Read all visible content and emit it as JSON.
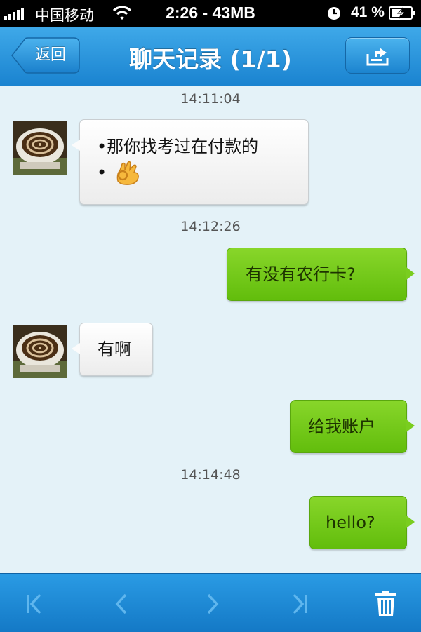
{
  "status_bar": {
    "carrier": "中国移动",
    "time_and_memory": "2:26 - 43MB",
    "battery_percent": "41 %",
    "icons": [
      "signal-bars-icon",
      "wifi-icon",
      "clock-icon",
      "battery-charging-icon"
    ]
  },
  "nav": {
    "title": "聊天记录 (1/1)",
    "back_label": "返回",
    "export_icon": "export-tray-icon"
  },
  "messages": [
    {
      "type": "timestamp",
      "text": "14:11:04"
    },
    {
      "type": "incoming",
      "lines": [
        "•那你找考过在付款的",
        "•"
      ],
      "emoji": "ok-hand-emoji-icon",
      "avatar": "coffee-cup-avatar"
    },
    {
      "type": "timestamp",
      "text": "14:12:26"
    },
    {
      "type": "outgoing",
      "text": "有没有农行卡?"
    },
    {
      "type": "incoming",
      "text": "有啊",
      "avatar": "coffee-cup-avatar"
    },
    {
      "type": "outgoing",
      "text": "给我账户"
    },
    {
      "type": "timestamp",
      "text": "14:14:48"
    },
    {
      "type": "outgoing",
      "text": "hello?"
    }
  ],
  "toolbar": {
    "buttons": [
      "first-page-icon",
      "previous-page-icon",
      "next-page-icon",
      "last-page-icon",
      "trash-icon"
    ]
  },
  "colors": {
    "nav_blue": "#1a83d0",
    "chat_background": "#e4f2f8",
    "outgoing_bubble": "#6cc31a",
    "incoming_bubble": "#f4f4f4"
  }
}
